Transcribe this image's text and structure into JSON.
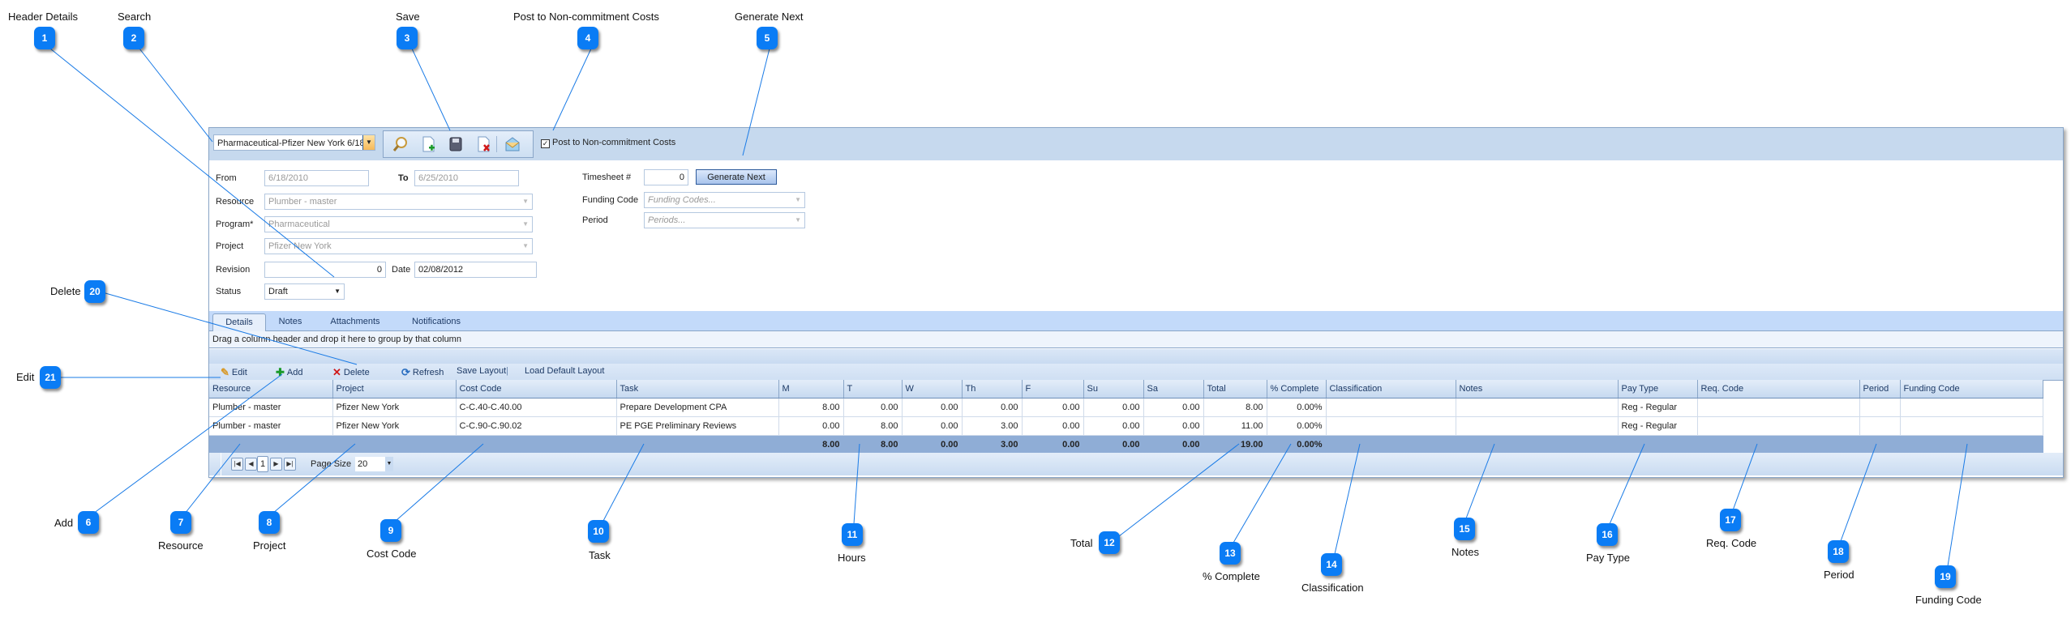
{
  "callouts": [
    {
      "n": "1",
      "label": "Header Details"
    },
    {
      "n": "2",
      "label": "Search"
    },
    {
      "n": "3",
      "label": "Save"
    },
    {
      "n": "4",
      "label": "Post to Non-commitment Costs"
    },
    {
      "n": "5",
      "label": "Generate Next"
    },
    {
      "n": "6",
      "label": "Add"
    },
    {
      "n": "7",
      "label": "Resource"
    },
    {
      "n": "8",
      "label": "Project"
    },
    {
      "n": "9",
      "label": "Cost Code"
    },
    {
      "n": "10",
      "label": "Task"
    },
    {
      "n": "11",
      "label": "Hours"
    },
    {
      "n": "12",
      "label": "Total"
    },
    {
      "n": "13",
      "label": "% Complete"
    },
    {
      "n": "14",
      "label": "Classification"
    },
    {
      "n": "15",
      "label": "Notes"
    },
    {
      "n": "16",
      "label": "Pay Type"
    },
    {
      "n": "17",
      "label": "Req. Code"
    },
    {
      "n": "18",
      "label": "Period"
    },
    {
      "n": "19",
      "label": "Funding Code"
    },
    {
      "n": "20",
      "label": "Delete"
    },
    {
      "n": "21",
      "label": "Edit"
    }
  ],
  "toolbar": {
    "record_selector": "Pharmaceutical-Pfizer New York 6/18",
    "icons": [
      "search-icon",
      "new-document-icon",
      "save-icon",
      "delete-document-icon",
      "email-icon"
    ],
    "post_checkbox_checked": true,
    "post_checkbox_label": "Post to Non-commitment Costs"
  },
  "form": {
    "from_label": "From",
    "from_value": "6/18/2010",
    "to_label": "To",
    "to_value": "6/25/2010",
    "resource_label": "Resource",
    "resource_value": "Plumber - master",
    "program_label": "Program*",
    "program_value": "Pharmaceutical",
    "project_label": "Project",
    "project_value": "Pfizer New York",
    "revision_label": "Revision",
    "revision_value": "0",
    "date_label": "Date",
    "date_value": "02/08/2012",
    "status_label": "Status",
    "status_value": "Draft",
    "timesheet_label": "Timesheet #",
    "timesheet_value": "0",
    "generate_next_label": "Generate Next",
    "funding_code_label": "Funding Code",
    "funding_code_placeholder": "Funding Codes...",
    "period_label": "Period",
    "period_placeholder": "Periods..."
  },
  "tabs": [
    "Details",
    "Notes",
    "Attachments",
    "Notifications"
  ],
  "active_tab": "Details",
  "group_bar_text": "Drag a column header and drop it here to group by that column",
  "commands": {
    "edit": "Edit",
    "add": "Add",
    "delete": "Delete",
    "refresh": "Refresh",
    "save_layout": "Save Layout",
    "separator": "|",
    "load_default": "Load Default Layout"
  },
  "grid": {
    "columns": [
      "Resource",
      "Project",
      "Cost Code",
      "Task",
      "M",
      "T",
      "W",
      "Th",
      "F",
      "Su",
      "Sa",
      "Total",
      "% Complete",
      "Classification",
      "Notes",
      "Pay Type",
      "Req. Code",
      "Period",
      "Funding Code"
    ],
    "rows": [
      [
        "Plumber - master",
        "Pfizer New York",
        "C-C.40-C.40.00",
        "Prepare Development CPA",
        "8.00",
        "0.00",
        "0.00",
        "0.00",
        "0.00",
        "0.00",
        "0.00",
        "8.00",
        "0.00%",
        "",
        "",
        "Reg - Regular",
        "",
        "",
        ""
      ],
      [
        "Plumber - master",
        "Pfizer New York",
        "C-C.90-C.90.02",
        "PE PGE Preliminary Reviews",
        "0.00",
        "8.00",
        "0.00",
        "3.00",
        "0.00",
        "0.00",
        "0.00",
        "11.00",
        "0.00%",
        "",
        "",
        "Reg - Regular",
        "",
        "",
        ""
      ]
    ],
    "footer": [
      "",
      "",
      "",
      "",
      "8.00",
      "8.00",
      "0.00",
      "3.00",
      "0.00",
      "0.00",
      "0.00",
      "19.00",
      "0.00%",
      "",
      "",
      "",
      "",
      "",
      ""
    ]
  },
  "pager": {
    "current_page": "1",
    "page_size_label": "Page Size",
    "page_size": "20"
  }
}
